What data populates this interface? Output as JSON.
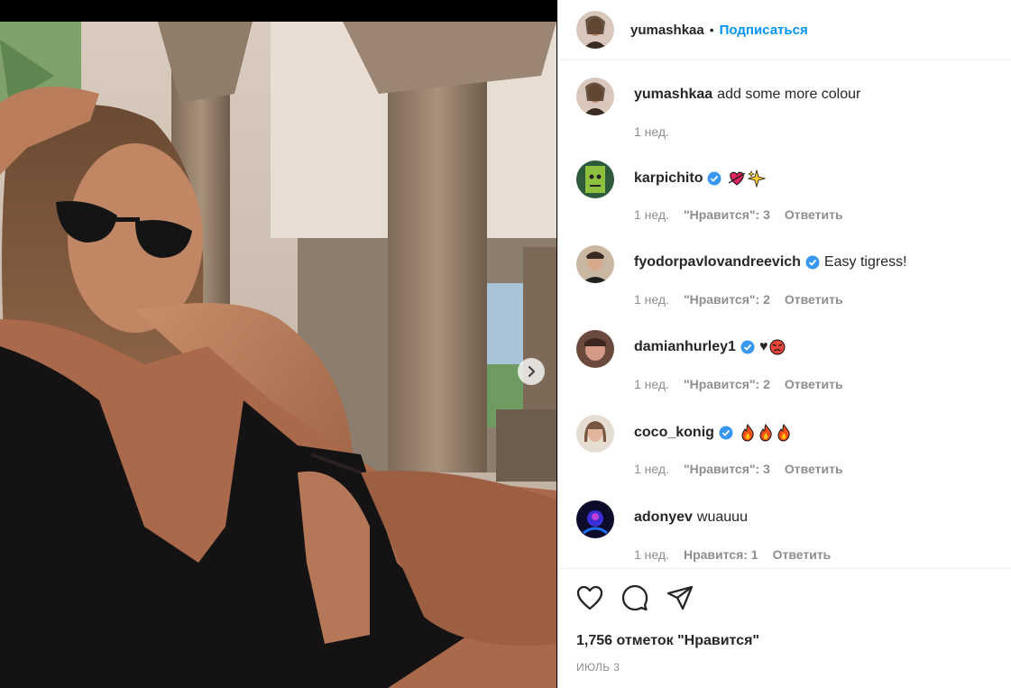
{
  "header": {
    "username": "yumashkaa",
    "separator": "•",
    "follow_label": "Подписаться"
  },
  "caption": {
    "username": "yumashkaa",
    "text": "add some more colour",
    "time": "1 нед."
  },
  "comments": [
    {
      "username": "karpichito",
      "verified": true,
      "text": "",
      "emojis": [
        "heart-arrow-emoji",
        "sparkles-emoji"
      ],
      "time": "1 нед.",
      "likes": "\"Нравится\": 3",
      "reply": "Ответить"
    },
    {
      "username": "fyodorpavlovandreevich",
      "verified": true,
      "text": "Easy tigress!",
      "emojis": [],
      "time": "1 нед.",
      "likes": "\"Нравится\": 2",
      "reply": "Ответить"
    },
    {
      "username": "damianhurley1",
      "verified": true,
      "text": "♥",
      "emojis": [
        "angry-face-emoji"
      ],
      "time": "1 нед.",
      "likes": "\"Нравится\": 2",
      "reply": "Ответить"
    },
    {
      "username": "coco_konig",
      "verified": true,
      "text": "",
      "emojis": [
        "fire-emoji",
        "fire-emoji",
        "fire-emoji"
      ],
      "time": "1 нед.",
      "likes": "\"Нравится\": 3",
      "reply": "Ответить"
    },
    {
      "username": "adonyev",
      "verified": false,
      "text": "wuauuu",
      "emojis": [],
      "time": "1 нед.",
      "likes": "Нравится: 1",
      "reply": "Ответить"
    }
  ],
  "actions": [
    "heart-icon",
    "comment-icon",
    "share-icon"
  ],
  "likes_total": "1,756 отметок \"Нравится\"",
  "date": "ИЮЛЬ 3",
  "colors": {
    "accent": "#0095f6",
    "text": "#262626",
    "muted": "#8e8e8e",
    "verified": "#3897f0"
  }
}
